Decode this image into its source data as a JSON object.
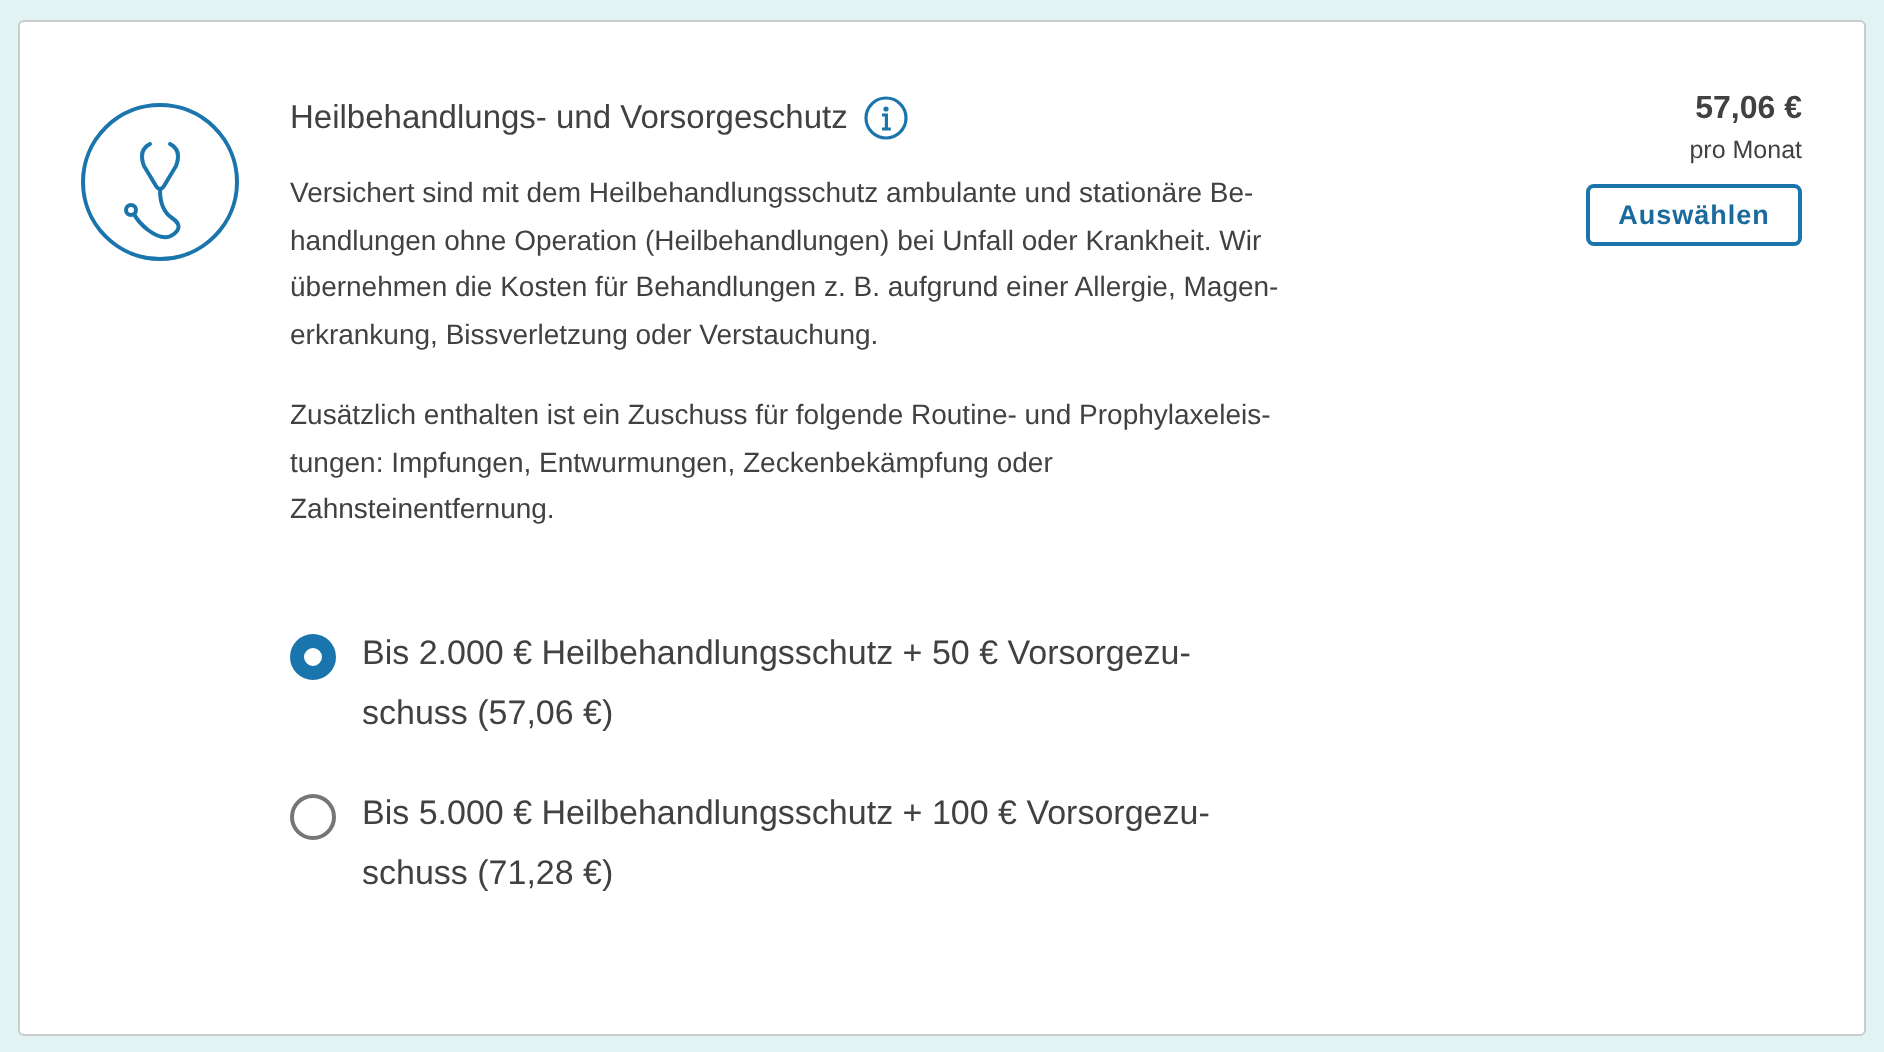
{
  "card": {
    "title": "Heilbehandlungs- und Vorsorgeschutz",
    "paragraphs": [
      "Versichert sind mit dem Heilbehandlungsschutz ambulante und stationäre Be-\nhandlungen ohne Operation (Heilbehandlungen) bei Unfall oder Krankheit. Wir\nübernehmen die Kosten für Behandlungen z. B. aufgrund einer Allergie, Magen-\nerkrankung, Bissverletzung oder Verstauchung.",
      "Zusätzlich enthalten ist ein Zuschuss für folgende Routine- und Prophylaxeleis-\ntungen: Impfungen, Entwurmungen, Zeckenbekämpfung oder\nZahnsteinentfernung."
    ],
    "price": "57,06 €",
    "price_unit": "pro Monat",
    "select_button": "Auswählen",
    "options": [
      {
        "label": "Bis 2.000 € Heilbehandlungsschutz + 50 € Vorsorgezu-\nschuss (57,06 €)",
        "selected": true
      },
      {
        "label": "Bis 5.000 € Heilbehandlungsschutz + 100 € Vorsorgezu-\nschuss (71,28 €)",
        "selected": false
      }
    ]
  }
}
